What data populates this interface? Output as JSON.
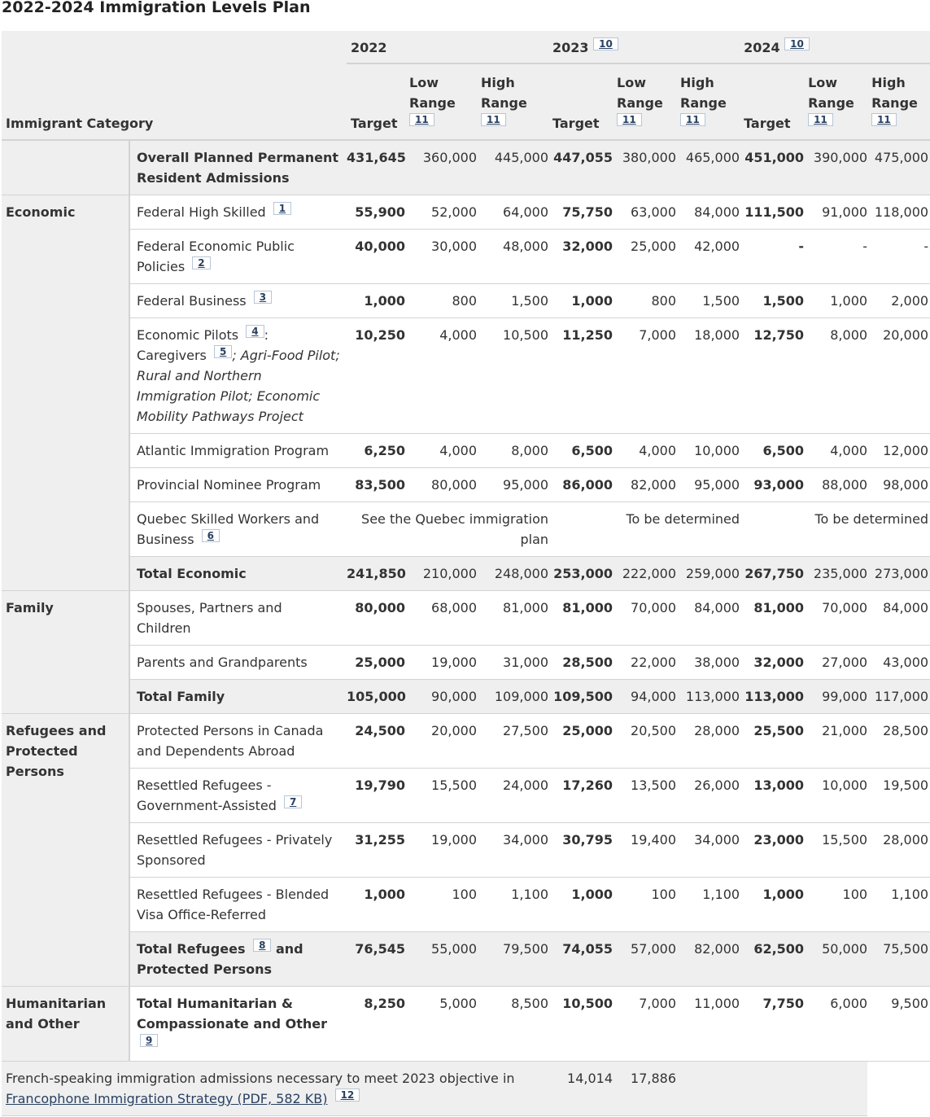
{
  "title": "2022-2024 Immigration Levels Plan",
  "header": {
    "category": "Immigrant Category",
    "years": [
      {
        "label": "2022",
        "note": ""
      },
      {
        "label": "2023",
        "note": "10"
      },
      {
        "label": "2024",
        "note": "10"
      }
    ],
    "target": "Target",
    "low": "Low Range",
    "high": "High Range",
    "range_note": "11"
  },
  "rows": [
    {
      "group": "",
      "label": "Overall Planned Permanent Resident Admissions",
      "values": [
        "431,645",
        "360,000",
        "445,000",
        "447,055",
        "380,000",
        "465,000",
        "451,000",
        "390,000",
        "475,000"
      ]
    },
    {
      "group": "Economic",
      "label": "Federal High Skilled",
      "note": "1",
      "values": [
        "55,900",
        "52,000",
        "64,000",
        "75,750",
        "63,000",
        "84,000",
        "111,500",
        "91,000",
        "118,000"
      ]
    },
    {
      "label": "Federal Economic Public Policies",
      "note": "2",
      "values": [
        "40,000",
        "30,000",
        "48,000",
        "32,000",
        "25,000",
        "42,000",
        "-",
        "-",
        "-"
      ]
    },
    {
      "label": "Federal Business",
      "note": "3",
      "values": [
        "1,000",
        "800",
        "1,500",
        "1,000",
        "800",
        "1,500",
        "1,500",
        "1,000",
        "2,000"
      ]
    },
    {
      "label_a": "Economic Pilots",
      "note_a": "4",
      "label_b": ": Caregivers",
      "note_b": "5",
      "label_c": "; Agri-Food Pilot; Rural and Northern Immigration Pilot; Economic Mobility Pathways Project",
      "values": [
        "10,250",
        "4,000",
        "10,500",
        "11,250",
        "7,000",
        "18,000",
        "12,750",
        "8,000",
        "20,000"
      ]
    },
    {
      "label": "Atlantic Immigration Program",
      "values": [
        "6,250",
        "4,000",
        "8,000",
        "6,500",
        "4,000",
        "10,000",
        "6,500",
        "4,000",
        "12,000"
      ]
    },
    {
      "label": "Provincial Nominee Program",
      "values": [
        "83,500",
        "80,000",
        "95,000",
        "86,000",
        "82,000",
        "95,000",
        "93,000",
        "88,000",
        "98,000"
      ]
    },
    {
      "label": "Quebec Skilled Workers and Business",
      "note": "6",
      "span_2022": "See the Quebec immigration plan",
      "span_2023": "To be determined",
      "span_2024": "To be determined"
    },
    {
      "label": "Total Economic",
      "values": [
        "241,850",
        "210,000",
        "248,000",
        "253,000",
        "222,000",
        "259,000",
        "267,750",
        "235,000",
        "273,000"
      ]
    },
    {
      "group": "Family",
      "label": "Spouses, Partners and Children",
      "values": [
        "80,000",
        "68,000",
        "81,000",
        "81,000",
        "70,000",
        "84,000",
        "81,000",
        "70,000",
        "84,000"
      ]
    },
    {
      "label": "Parents and Grandparents",
      "values": [
        "25,000",
        "19,000",
        "31,000",
        "28,500",
        "22,000",
        "38,000",
        "32,000",
        "27,000",
        "43,000"
      ]
    },
    {
      "label": "Total Family",
      "values": [
        "105,000",
        "90,000",
        "109,000",
        "109,500",
        "94,000",
        "113,000",
        "113,000",
        "99,000",
        "117,000"
      ]
    },
    {
      "group": "Refugees and Protected Persons",
      "label": "Protected Persons in Canada and Dependents Abroad",
      "values": [
        "24,500",
        "20,000",
        "27,500",
        "25,000",
        "20,500",
        "28,000",
        "25,500",
        "21,000",
        "28,500"
      ]
    },
    {
      "label": "Resettled Refugees - Government-Assisted",
      "note": "7",
      "values": [
        "19,790",
        "15,500",
        "24,000",
        "17,260",
        "13,500",
        "26,000",
        "13,000",
        "10,000",
        "19,500"
      ]
    },
    {
      "label": "Resettled Refugees - Privately Sponsored",
      "values": [
        "31,255",
        "19,000",
        "34,000",
        "30,795",
        "19,400",
        "34,000",
        "23,000",
        "15,500",
        "28,000"
      ]
    },
    {
      "label": "Resettled Refugees - Blended Visa Office-Referred",
      "values": [
        "1,000",
        "100",
        "1,100",
        "1,000",
        "100",
        "1,100",
        "1,000",
        "100",
        "1,100"
      ]
    },
    {
      "label_a": "Total Refugees",
      "note_a": "8",
      "label_b": "and Protected Persons",
      "values": [
        "76,545",
        "55,000",
        "79,500",
        "74,055",
        "57,000",
        "82,000",
        "62,500",
        "50,000",
        "75,500"
      ]
    },
    {
      "group": "Humanitarian and Other",
      "label": "Total Humanitarian & Compassionate and Other",
      "note": "9",
      "values": [
        "8,250",
        "5,000",
        "8,500",
        "10,500",
        "7,000",
        "11,000",
        "7,750",
        "6,000",
        "9,500"
      ]
    }
  ],
  "footer": {
    "text": "French-speaking immigration admissions necessary to meet 2023 objective in ",
    "link": "Francophone Immigration Strategy (PDF, 582 KB)",
    "note": "12",
    "low": "14,014",
    "high": "17,886"
  }
}
